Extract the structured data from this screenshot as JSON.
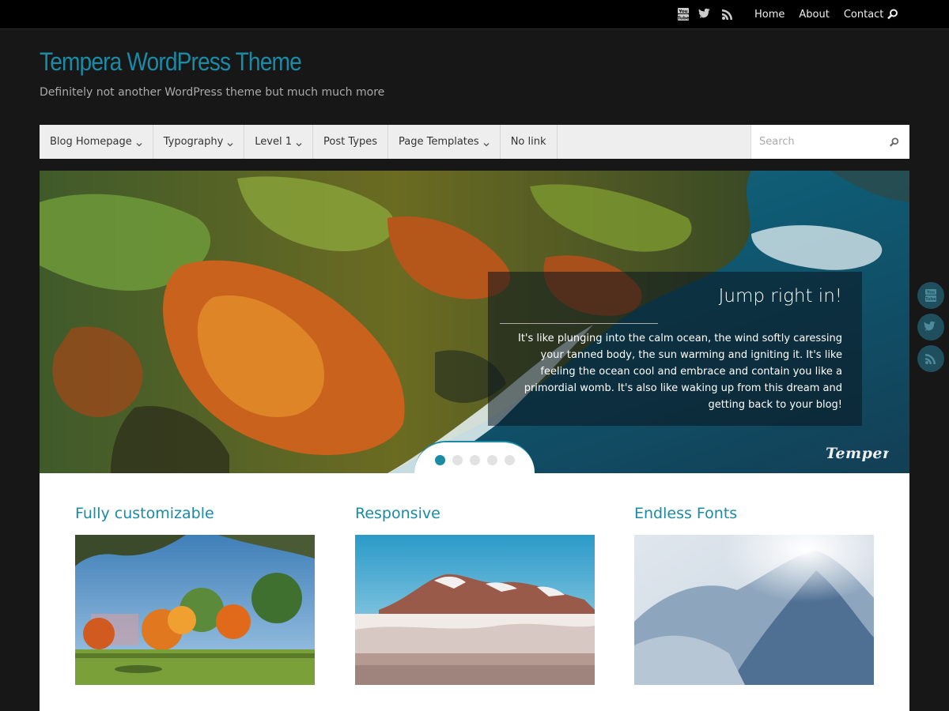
{
  "topbar": {
    "social_icons": [
      "youtube-icon",
      "twitter-icon",
      "rss-icon"
    ],
    "links": [
      "Home",
      "About",
      "Contact"
    ],
    "search_icon": "search-icon"
  },
  "site": {
    "title": "Tempera WordPress Theme",
    "description": "Definitely not another WordPress theme but much much more"
  },
  "nav": {
    "items": [
      {
        "label": "Blog Homepage",
        "has_submenu": true
      },
      {
        "label": "Typography",
        "has_submenu": true
      },
      {
        "label": "Level 1",
        "has_submenu": true
      },
      {
        "label": "Post Types",
        "has_submenu": false
      },
      {
        "label": "Page Templates",
        "has_submenu": true
      },
      {
        "label": "No link",
        "has_submenu": false
      }
    ],
    "search_placeholder": "Search"
  },
  "slider": {
    "caption_title": "Jump right in!",
    "caption_text": "It's like plunging into the calm ocean, the wind softly caressing your tanned body, the sun warming and igniting it. It's like feeling the ocean cool and embrace and contain you like a primordial womb. It's also like waking up from this dream and getting back to your blog!",
    "active_slide": 1,
    "total_slides": 5
  },
  "columns": [
    {
      "title": "Fully customizable"
    },
    {
      "title": "Responsive"
    },
    {
      "title": "Endless Fonts"
    }
  ],
  "side_social": [
    "youtube-icon",
    "twitter-icon",
    "rss-icon"
  ],
  "colors": {
    "accent": "#1a8aa5",
    "background": "#171717",
    "topbar": "#000000",
    "nav": "#eeeeee"
  }
}
